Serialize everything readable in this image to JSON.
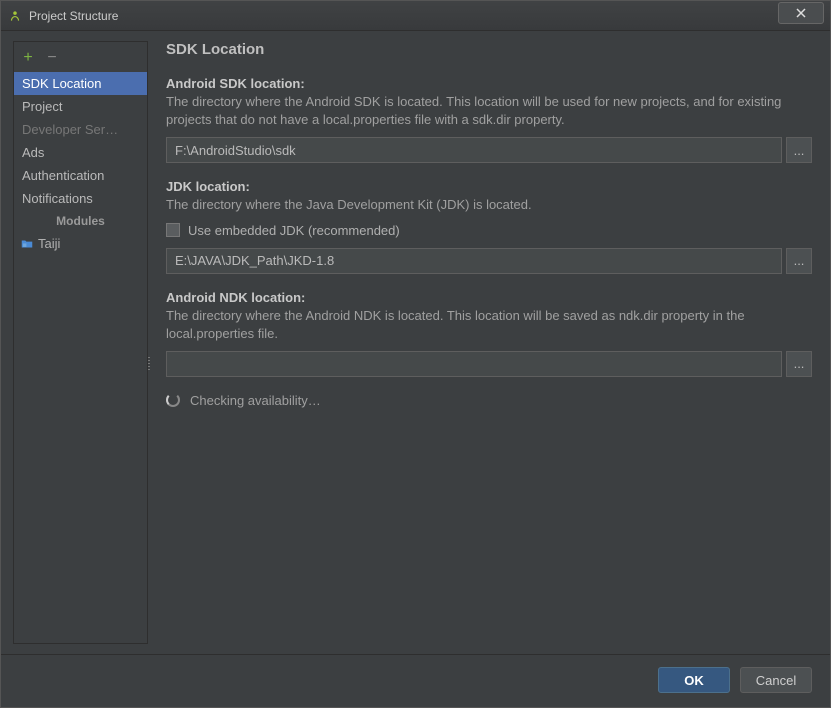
{
  "window": {
    "title": "Project Structure"
  },
  "sidebar": {
    "items": [
      {
        "label": "SDK Location",
        "selected": true
      },
      {
        "label": "Project"
      },
      {
        "label": "Developer Ser…",
        "dim": true
      },
      {
        "label": "Ads"
      },
      {
        "label": "Authentication"
      },
      {
        "label": "Notifications"
      }
    ],
    "modules_header": "Modules",
    "modules": [
      {
        "label": "Taiji"
      }
    ]
  },
  "content": {
    "title": "SDK Location",
    "android_sdk": {
      "label": "Android SDK location:",
      "desc": "The directory where the Android SDK is located. This location will be used for new projects, and for existing projects that do not have a local.properties file with a sdk.dir property.",
      "value": "F:\\AndroidStudio\\sdk"
    },
    "jdk": {
      "label": "JDK location:",
      "desc": "The directory where the Java Development Kit (JDK) is located.",
      "checkbox_label": "Use embedded JDK (recommended)",
      "value": "E:\\JAVA\\JDK_Path\\JKD-1.8"
    },
    "ndk": {
      "label": "Android NDK location:",
      "desc": "The directory where the Android NDK is located. This location will be saved as ndk.dir property in the local.properties file.",
      "value": ""
    },
    "status_text": "Checking availability…"
  },
  "footer": {
    "ok_label": "OK",
    "cancel_label": "Cancel"
  },
  "browse_label": "..."
}
